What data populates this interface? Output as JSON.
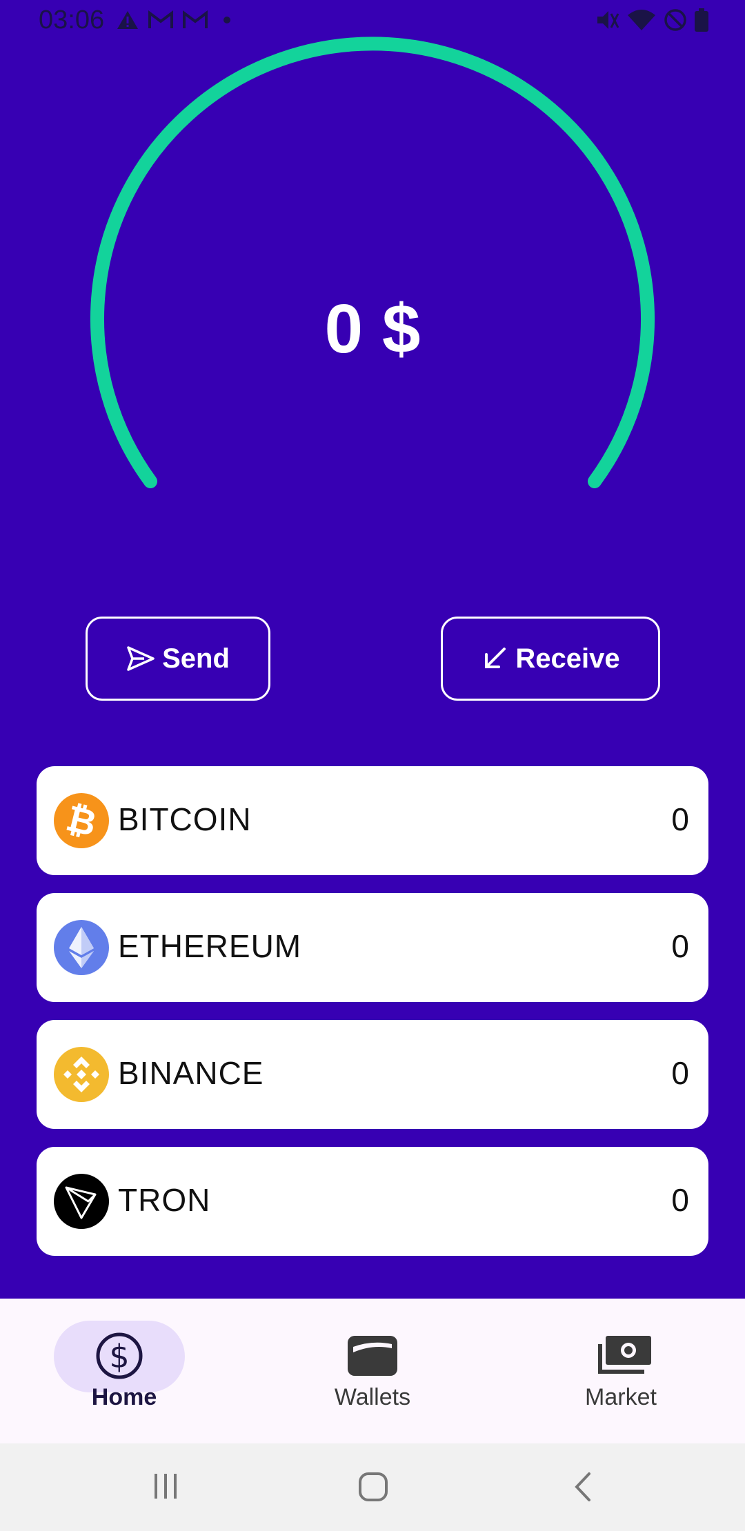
{
  "status_bar": {
    "time": "03:06",
    "left_icons": [
      "warning-icon",
      "gmail-icon",
      "gmail-icon",
      "dot-icon"
    ],
    "right_icons": [
      "mute-icon",
      "wifi-icon",
      "do-not-disturb-icon",
      "battery-icon"
    ]
  },
  "gauge": {
    "balance_text": "0 $",
    "arc_color": "#13d39b"
  },
  "actions": {
    "send_label": "Send",
    "receive_label": "Receive"
  },
  "coins": [
    {
      "name": "BITCOIN",
      "value": "0",
      "icon": "bitcoin-icon",
      "color": "#f7931a"
    },
    {
      "name": "ETHEREUM",
      "value": "0",
      "icon": "ethereum-icon",
      "color": "#627eea"
    },
    {
      "name": "BINANCE",
      "value": "0",
      "icon": "binance-icon",
      "color": "#f3ba2f"
    },
    {
      "name": "TRON",
      "value": "0",
      "icon": "tron-icon",
      "color": "#000000"
    }
  ],
  "bottom_nav": {
    "items": [
      {
        "label": "Home",
        "icon": "dollar-circle-icon",
        "active": true
      },
      {
        "label": "Wallets",
        "icon": "wallet-icon",
        "active": false
      },
      {
        "label": "Market",
        "icon": "cash-icon",
        "active": false
      }
    ]
  },
  "colors": {
    "background": "#3700b3",
    "accent": "#13d39b",
    "nav_active_pill": "#e8ddfb"
  }
}
